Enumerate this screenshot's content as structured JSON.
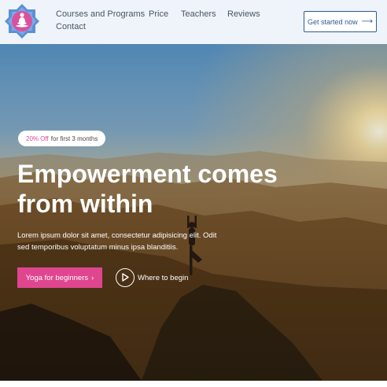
{
  "header": {
    "nav": [
      "Courses and Programs",
      "Price",
      "Teachers",
      "Reviews",
      "Contact"
    ],
    "cta_label": "Get started now",
    "cta_icon": "arrow-right-icon",
    "logo_icon": "lotus-meditation-icon",
    "colors": {
      "logo_outer": "#5b8fd6",
      "logo_inner": "#d9519d",
      "cta": "#2f5a8e"
    }
  },
  "hero": {
    "badge_accent": "20% Off",
    "badge_text": "for first 3 months",
    "headline": "Empowerment comes from within",
    "subtext": "Lorem ipsum dolor sit amet, consectetur adipisicing elit. Odit sed temporibus voluptatum minus ipsa blanditiis.",
    "primary_button": "Yoga for beginners",
    "primary_button_icon": "chevron-right-icon",
    "secondary_link": "Where to begin",
    "secondary_icon": "play-icon",
    "colors": {
      "accent": "#e0468f",
      "text": "#ffffff"
    }
  }
}
